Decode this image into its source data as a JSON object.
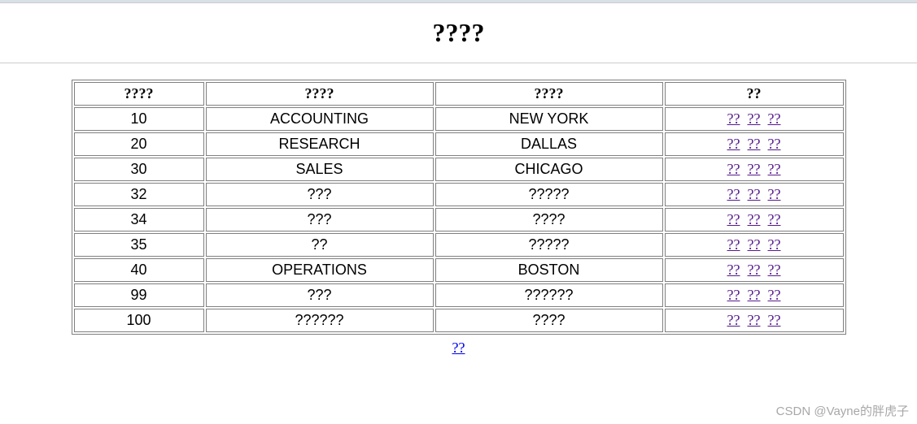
{
  "page": {
    "title": "????",
    "bottom_link": "??",
    "watermark": "CSDN @Vayne的胖虎子"
  },
  "table": {
    "headers": {
      "id": "????",
      "name": "????",
      "loc": "????",
      "ops": "??"
    },
    "op_labels": {
      "a": "??",
      "b": "??",
      "c": "??"
    },
    "rows": [
      {
        "id": "10",
        "name": "ACCOUNTING",
        "loc": "NEW YORK"
      },
      {
        "id": "20",
        "name": "RESEARCH",
        "loc": "DALLAS"
      },
      {
        "id": "30",
        "name": "SALES",
        "loc": "CHICAGO"
      },
      {
        "id": "32",
        "name": "???",
        "loc": "?????"
      },
      {
        "id": "34",
        "name": "???",
        "loc": "????"
      },
      {
        "id": "35",
        "name": "??",
        "loc": "?????"
      },
      {
        "id": "40",
        "name": "OPERATIONS",
        "loc": "BOSTON"
      },
      {
        "id": "99",
        "name": "???",
        "loc": "??????"
      },
      {
        "id": "100",
        "name": "??????",
        "loc": "????"
      }
    ]
  }
}
